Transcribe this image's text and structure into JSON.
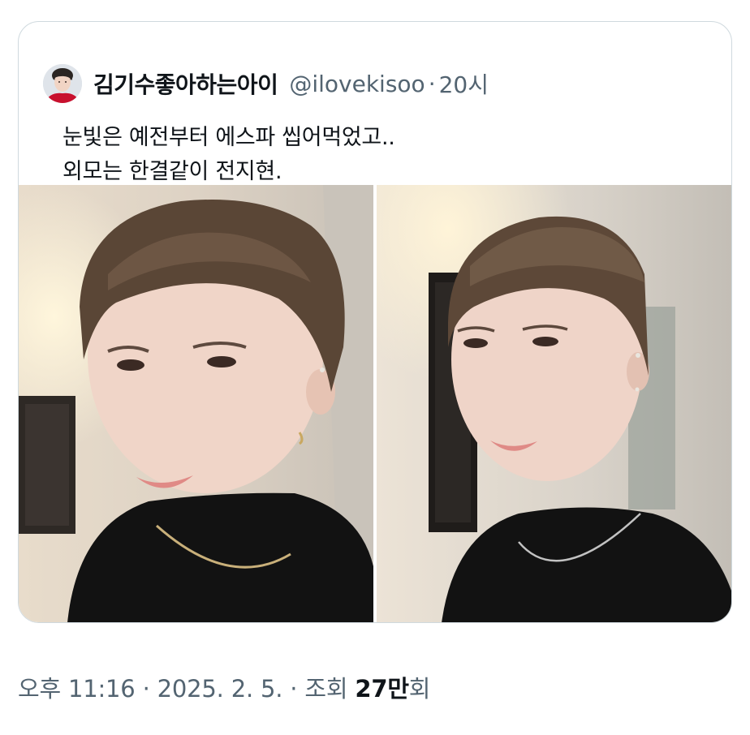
{
  "quote": {
    "author_name": "김기수좋아하는아이",
    "author_handle": "@ilovekisoo",
    "separator": "·",
    "post_age": "20시",
    "text_lines": [
      "눈빛은 예전부터 에스파 씹어먹었고..",
      "외모는 한결같이 전지현."
    ],
    "media": [
      {
        "kind": "photo",
        "icon": "photo-icon"
      },
      {
        "kind": "photo",
        "icon": "photo-icon"
      }
    ]
  },
  "meta": {
    "time": "오후 11:16",
    "separator": "·",
    "date": "2025. 2. 5.",
    "views_label": "조회",
    "views_count": "27만",
    "views_suffix": "회"
  },
  "colors": {
    "text_primary": "#0f1419",
    "text_secondary": "#536471",
    "card_border": "#cfd9de",
    "background": "#ffffff"
  }
}
